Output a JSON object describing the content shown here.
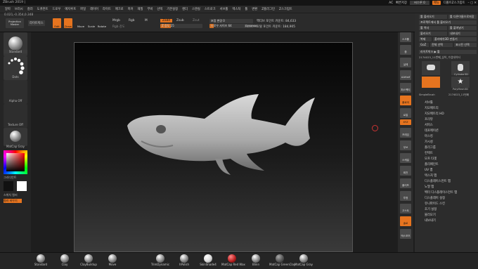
{
  "app_title": "ZBrush 2019 |",
  "menu": [
    "알파",
    "브러시",
    "컬러",
    "도큐먼트",
    "드로우",
    "에지루프",
    "파일",
    "레이어",
    "라이트",
    "매크로",
    "마커",
    "재질",
    "무비",
    "선택",
    "기본설정",
    "렌더",
    "스텐실",
    "스트로크",
    "서브툴",
    "텍스처",
    "툴",
    "변환",
    "Z플러그인",
    "Z스크립트"
  ],
  "top_right": {
    "ac_label": "AC",
    "quick_save": "빠른저장",
    "see_through": "씨스루 0",
    "menus_label": "메뉴",
    "default_script": "디폴트Z스크립트"
  },
  "coords": "0.021,-0.354,0.348",
  "topbar": {
    "projection_master": "Projection Master",
    "lightbox": "라이트박스",
    "edit": "Edit",
    "draw": "Draw",
    "move": "Move",
    "scale": "Scale",
    "rotate": "Rotate",
    "mrgb": "Mrgb",
    "rgb": "Rgb",
    "m": "M",
    "zadd": "Zadd",
    "zsub": "Zsub",
    "zcut": "Zcut",
    "rgb_intensity": "Rgb 강도",
    "z_intensity": "Z 강도 25",
    "focal_shift": "초점 변경 0",
    "draw_size": "드로우 사이즈 64",
    "dynamic": "Dynamic",
    "active_points": "액티브 포인트 카운트: 84,633",
    "total_points": "토탈 포인트 카운트: 184,905"
  },
  "left_panel": {
    "brush": "Standard",
    "stroke": "Dots",
    "alpha": "Alpha Off",
    "texture": "Texture Off",
    "material": "MatCap Gray",
    "gradient": "그라디언트",
    "switch_color": "스위치 컬러",
    "alternate": "컬러 바꾸기"
  },
  "right_tools": [
    "스크롤",
    "줌",
    "실제",
    "AAHalf",
    "퍼스펙티브",
    "플로어",
    "로컬",
    "XYZ",
    "프레임",
    "무브",
    "스케일",
    "회전",
    "폴리프",
    "투명",
    "고스트",
    "솔로",
    "엑스포즈"
  ],
  "right_panel": {
    "buttons": [
      "툴 불러오기",
      "툴 다른이름으로저장",
      "프로젝트에서 툴 불러오기",
      "툴 복사",
      "툴 붙여넣기",
      "불러오기",
      "내보내기",
      "복제",
      "폴리메쉬3D 만들기",
      "GoZ",
      "전체 선택",
      "표시된 선택",
      "라이트박스 ▶ 툴"
    ],
    "current_tool": "2174023_11번째_상어_수업데이터",
    "tools": [
      "SimpleBrush",
      "Cylinder3D",
      "PolyMesh3D",
      "2174023_11번째"
    ],
    "sub_menus": [
      "서브툴",
      "지오메트리",
      "지오메트리 HD",
      "프리뷰",
      "서피스",
      "데포메이션",
      "마스킹",
      "가시성",
      "폴리그룹",
      "컨택트",
      "모프 타겟",
      "폴리페인트",
      "UV 맵",
      "텍스처 맵",
      "디스플레이스먼트 맵",
      "노멀 맵",
      "벡터 디스플레이스먼트 맵",
      "디스플레이 설정",
      "유니파이드 스킨",
      "초기 설정",
      "불러오기",
      "내보내기"
    ]
  },
  "bottom_materials": [
    "Standard",
    "Clay",
    "ClayBuildup",
    "Move",
    "TrimDynamic",
    "hPolish",
    "SkinShade4",
    "MatCap Red Wax",
    "Blinn",
    "MatCap GreenClay",
    "MatCap Gray"
  ],
  "colors": {
    "accent": "#e6741f",
    "panel": "#2b2b2b",
    "background": "#1e1e1e"
  }
}
